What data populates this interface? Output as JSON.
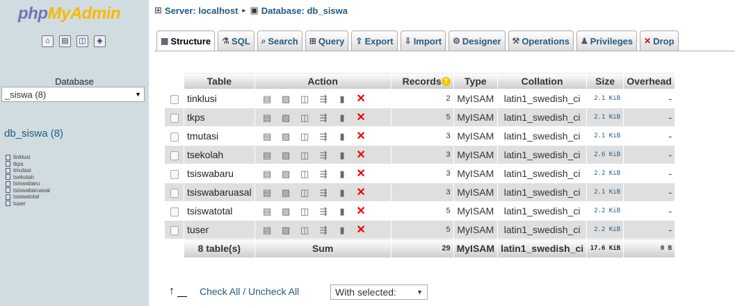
{
  "nav": {
    "logo": {
      "php": "php",
      "my": "My",
      "admin": "Admin"
    },
    "icons": [
      "home-icon",
      "sql-icon",
      "docs-icon",
      "settings-icon"
    ],
    "database_label": "Database",
    "database_select": "_siswa (8)",
    "db_link": "db_siswa (8)",
    "tables": [
      "tinklusi",
      "tkps",
      "tmutasi",
      "tsekolah",
      "tsiswabaru",
      "tsiswabaruasal",
      "tsiswatotal",
      "tuser"
    ]
  },
  "breadcrumb": {
    "server": "Server: localhost",
    "separator": "▸",
    "database": "Database: db_siswa"
  },
  "tabs": [
    {
      "label": "Structure",
      "icon": "structure-icon",
      "active": true
    },
    {
      "label": "SQL",
      "icon": "sql-icon"
    },
    {
      "label": "Search",
      "icon": "search-icon"
    },
    {
      "label": "Query",
      "icon": "query-icon"
    },
    {
      "label": "Export",
      "icon": "export-icon"
    },
    {
      "label": "Import",
      "icon": "import-icon"
    },
    {
      "label": "Designer",
      "icon": "designer-icon"
    },
    {
      "label": "Operations",
      "icon": "operations-icon"
    },
    {
      "label": "Privileges",
      "icon": "privileges-icon"
    },
    {
      "label": "Drop",
      "icon": "drop-icon"
    }
  ],
  "table": {
    "headers": {
      "table": "Table",
      "action": "Action",
      "records": "Records",
      "type": "Type",
      "collation": "Collation",
      "size": "Size",
      "overhead": "Overhead"
    },
    "action_icons": [
      "browse-icon",
      "structure-icon",
      "search-icon",
      "insert-icon",
      "empty-icon",
      "drop-icon"
    ],
    "rows": [
      {
        "name": "tinklusi",
        "records": "2",
        "type": "MyISAM",
        "collation": "latin1_swedish_ci",
        "size": "2.1 KiB",
        "overhead": "-"
      },
      {
        "name": "tkps",
        "records": "5",
        "type": "MyISAM",
        "collation": "latin1_swedish_ci",
        "size": "2.1 KiB",
        "overhead": "-"
      },
      {
        "name": "tmutasi",
        "records": "3",
        "type": "MyISAM",
        "collation": "latin1_swedish_ci",
        "size": "2.1 KiB",
        "overhead": "-"
      },
      {
        "name": "tsekolah",
        "records": "3",
        "type": "MyISAM",
        "collation": "latin1_swedish_ci",
        "size": "2.6 KiB",
        "overhead": "-"
      },
      {
        "name": "tsiswabaru",
        "records": "3",
        "type": "MyISAM",
        "collation": "latin1_swedish_ci",
        "size": "2.2 KiB",
        "overhead": "-"
      },
      {
        "name": "tsiswabaruasal",
        "records": "3",
        "type": "MyISAM",
        "collation": "latin1_swedish_ci",
        "size": "2.1 KiB",
        "overhead": "-"
      },
      {
        "name": "tsiswatotal",
        "records": "5",
        "type": "MyISAM",
        "collation": "latin1_swedish_ci",
        "size": "2.2 KiB",
        "overhead": "-"
      },
      {
        "name": "tuser",
        "records": "5",
        "type": "MyISAM",
        "collation": "latin1_swedish_ci",
        "size": "2.2 KiB",
        "overhead": "-"
      }
    ],
    "footer": {
      "tables": "8 table(s)",
      "sum": "Sum",
      "records": "29",
      "type": "MyISAM",
      "collation": "latin1_swedish_ci",
      "size": "17.6 KiB",
      "overhead": "0 B"
    }
  },
  "bottom": {
    "check_all": "Check All / Uncheck All",
    "with_selected": "With selected:"
  }
}
